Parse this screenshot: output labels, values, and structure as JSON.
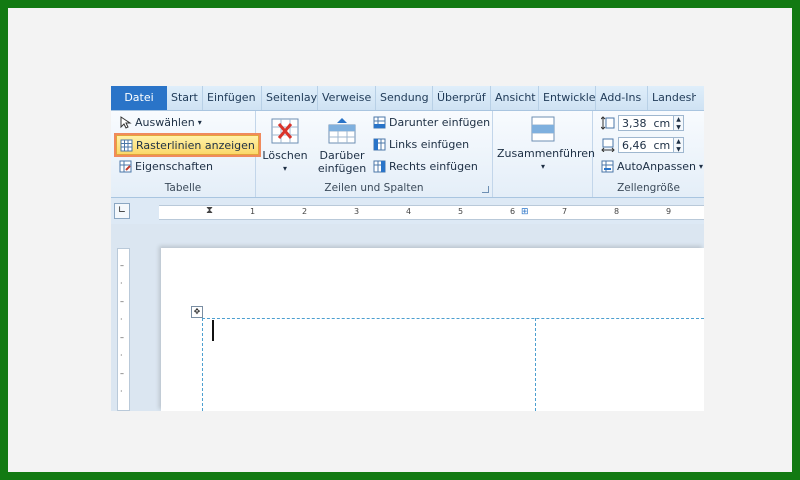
{
  "tabs": [
    "Datei",
    "Start",
    "Einfügen",
    "Seitenlay",
    "Verweise",
    "Sendung",
    "Überprüf",
    "Ansicht",
    "Entwickle",
    "Add-Ins",
    "Landesha"
  ],
  "ribbon": {
    "tabelle": {
      "select_label": "Auswählen",
      "gridlines_label": "Rasterlinien anzeigen",
      "properties_label": "Eigenschaften",
      "group_label": "Tabelle"
    },
    "zeilen": {
      "delete_label": "Löschen",
      "insert_above_line1": "Darüber",
      "insert_above_line2": "einfügen",
      "insert_below_label": "Darunter einfügen",
      "insert_left_label": "Links einfügen",
      "insert_right_label": "Rechts einfügen",
      "group_label": "Zeilen und Spalten"
    },
    "merge": {
      "merge_label": "Zusammenführen"
    },
    "cellsize": {
      "height_value": "3,38",
      "height_unit": "cm",
      "width_value": "6,46",
      "width_unit": "cm",
      "autofit_label": "AutoAnpassen",
      "group_label": "Zellengröße"
    }
  },
  "ruler": {
    "ticks": [
      "1",
      "2",
      "3",
      "4",
      "5",
      "6",
      "7",
      "8",
      "9"
    ]
  }
}
